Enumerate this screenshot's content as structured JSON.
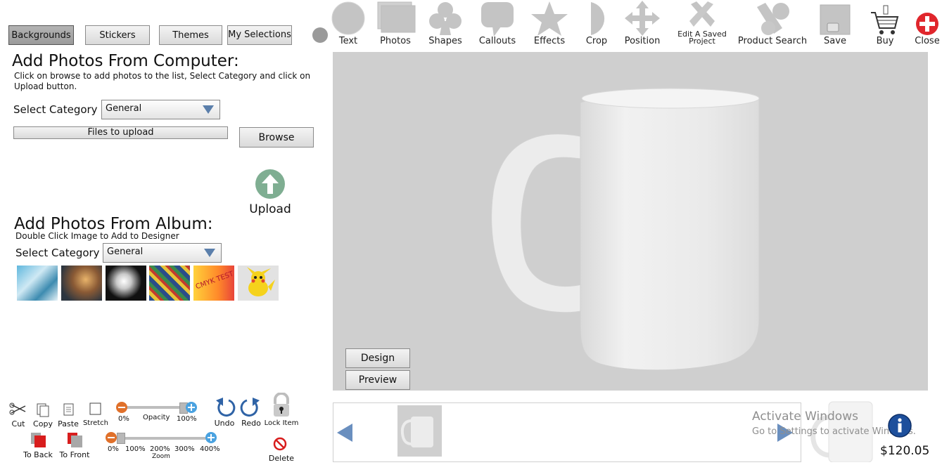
{
  "tabs": {
    "backgrounds": "Backgrounds",
    "stickers": "Stickers",
    "themes": "Themes",
    "my_selections": "My Selections"
  },
  "toolbar": {
    "text": "Text",
    "photos": "Photos",
    "shapes": "Shapes",
    "callouts": "Callouts",
    "effects": "Effects",
    "crop": "Crop",
    "position": "Position",
    "edit_saved_line1": "Edit A Saved",
    "edit_saved_line2": "Project",
    "product_search": "Product Search",
    "save": "Save",
    "buy": "Buy",
    "close": "Close"
  },
  "computer_section": {
    "title": "Add Photos From Computer:",
    "instructions_line1": "Click on browse to add photos to the list, Select Category and click on",
    "instructions_line2": "Upload button.",
    "category_label": "Select Category",
    "category_value": "General",
    "files_to_upload": "Files to upload",
    "browse": "Browse",
    "upload": "Upload"
  },
  "album_section": {
    "title": "Add Photos From Album:",
    "subtitle": "Double Click Image to Add to Designer",
    "category_label": "Select Category",
    "category_value": "General",
    "cmyk_text": "CMYK TEST"
  },
  "bottom_tools": {
    "cut": "Cut",
    "copy": "Copy",
    "paste": "Paste",
    "stretch": "Stretch",
    "opacity_min": "0%",
    "opacity_label": "Opacity",
    "opacity_max": "100%",
    "opacity_value": 1.0,
    "undo": "Undo",
    "redo": "Redo",
    "lock_item": "Lock Item",
    "to_back": "To Back",
    "to_front": "To Front",
    "zoom_0": "0%",
    "zoom_100": "100%",
    "zoom_200": "200%",
    "zoom_300": "300%",
    "zoom_400": "400%",
    "zoom_label": "Zoom",
    "delete": "Delete"
  },
  "canvas": {
    "design": "Design",
    "preview": "Preview"
  },
  "footer": {
    "watermark_line1": "Activate Windows",
    "watermark_line2": "Go to Settings to activate Windows.",
    "price": "$120.05"
  },
  "colors": {
    "canvas_bg": "#cfcfcf",
    "upload_green": "#7fae92",
    "close_red": "#e0262c",
    "arrow_blue": "#6a8fbf",
    "slider_orange": "#e0702a",
    "slider_blue": "#4aa2e0"
  }
}
